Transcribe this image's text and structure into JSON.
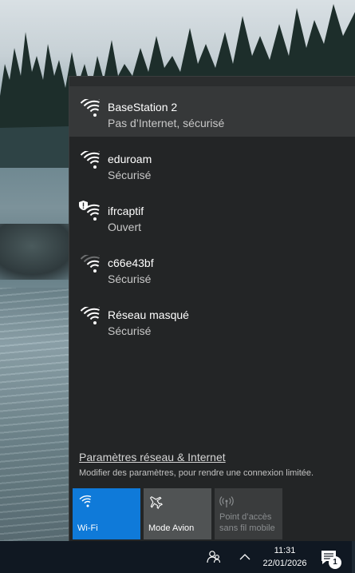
{
  "networks": [
    {
      "name": "BaseStation 2",
      "status": "Pas d’Internet, sécurisé",
      "selected": true,
      "icon": "wifi-icon"
    },
    {
      "name": "eduroam",
      "status": "Sécurisé",
      "icon": "wifi-icon"
    },
    {
      "name": "ifrcaptif",
      "status": "Ouvert",
      "icon": "wifi-open-shield-icon"
    },
    {
      "name": "c66e43bf",
      "status": "Sécurisé",
      "icon": "wifi-weak-icon"
    },
    {
      "name": "Réseau masqué",
      "status": "Sécurisé",
      "icon": "wifi-icon"
    }
  ],
  "settings": {
    "link": "Paramètres réseau & Internet",
    "sub": "Modifier des paramètres, pour rendre une connexion limitée."
  },
  "quick_actions": [
    {
      "label": "Wi-Fi",
      "icon": "wifi-icon",
      "state": "on",
      "color": "#0f7ad9"
    },
    {
      "label": "Mode Avion",
      "icon": "airplane-icon",
      "state": "off"
    },
    {
      "label": "Point d’accès sans fil mobile",
      "label_line1": "Point d’accès",
      "label_line2": "sans fil mobile",
      "icon": "hotspot-icon",
      "state": "disabled"
    }
  ],
  "taskbar": {
    "time": "11:31",
    "date": "22/01/2026",
    "notification_count": "1",
    "icons": [
      "people-icon",
      "chevron-up-icon",
      "notification-icon"
    ]
  },
  "colors": {
    "accent": "#0f7ad9",
    "flyout_bg": "#232526",
    "taskbar_bg": "#101822"
  }
}
